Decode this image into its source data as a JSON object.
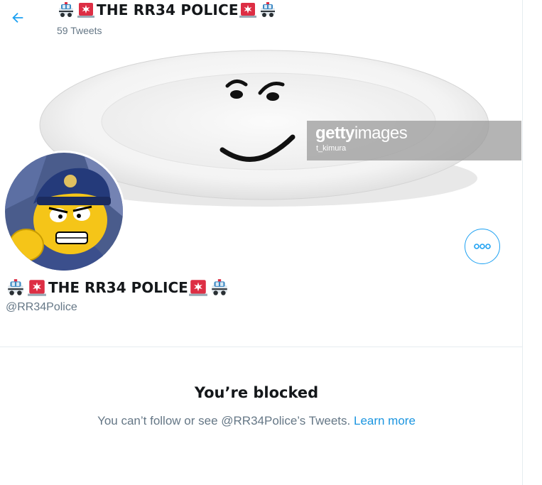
{
  "header": {
    "title": "THE RR34 POLICE",
    "tweet_count": "59 Tweets"
  },
  "banner": {
    "watermark_brand_bold": "getty",
    "watermark_brand_light": "images",
    "watermark_credit": "t_kimura"
  },
  "profile": {
    "name": "THE RR34 POLICE",
    "handle": "@RR34Police"
  },
  "blocked": {
    "title": "You’re blocked",
    "message": "You can’t follow or see @RR34Police’s Tweets.",
    "link": "Learn more"
  },
  "icons": {
    "back": "back-arrow-icon",
    "more": "more-options-icon",
    "emoji_car": "police-car-emoji",
    "emoji_siren": "siren-light-emoji"
  },
  "colors": {
    "accent": "#1da1f2",
    "link": "#1b95e0",
    "muted": "#657786",
    "text": "#14171a"
  }
}
